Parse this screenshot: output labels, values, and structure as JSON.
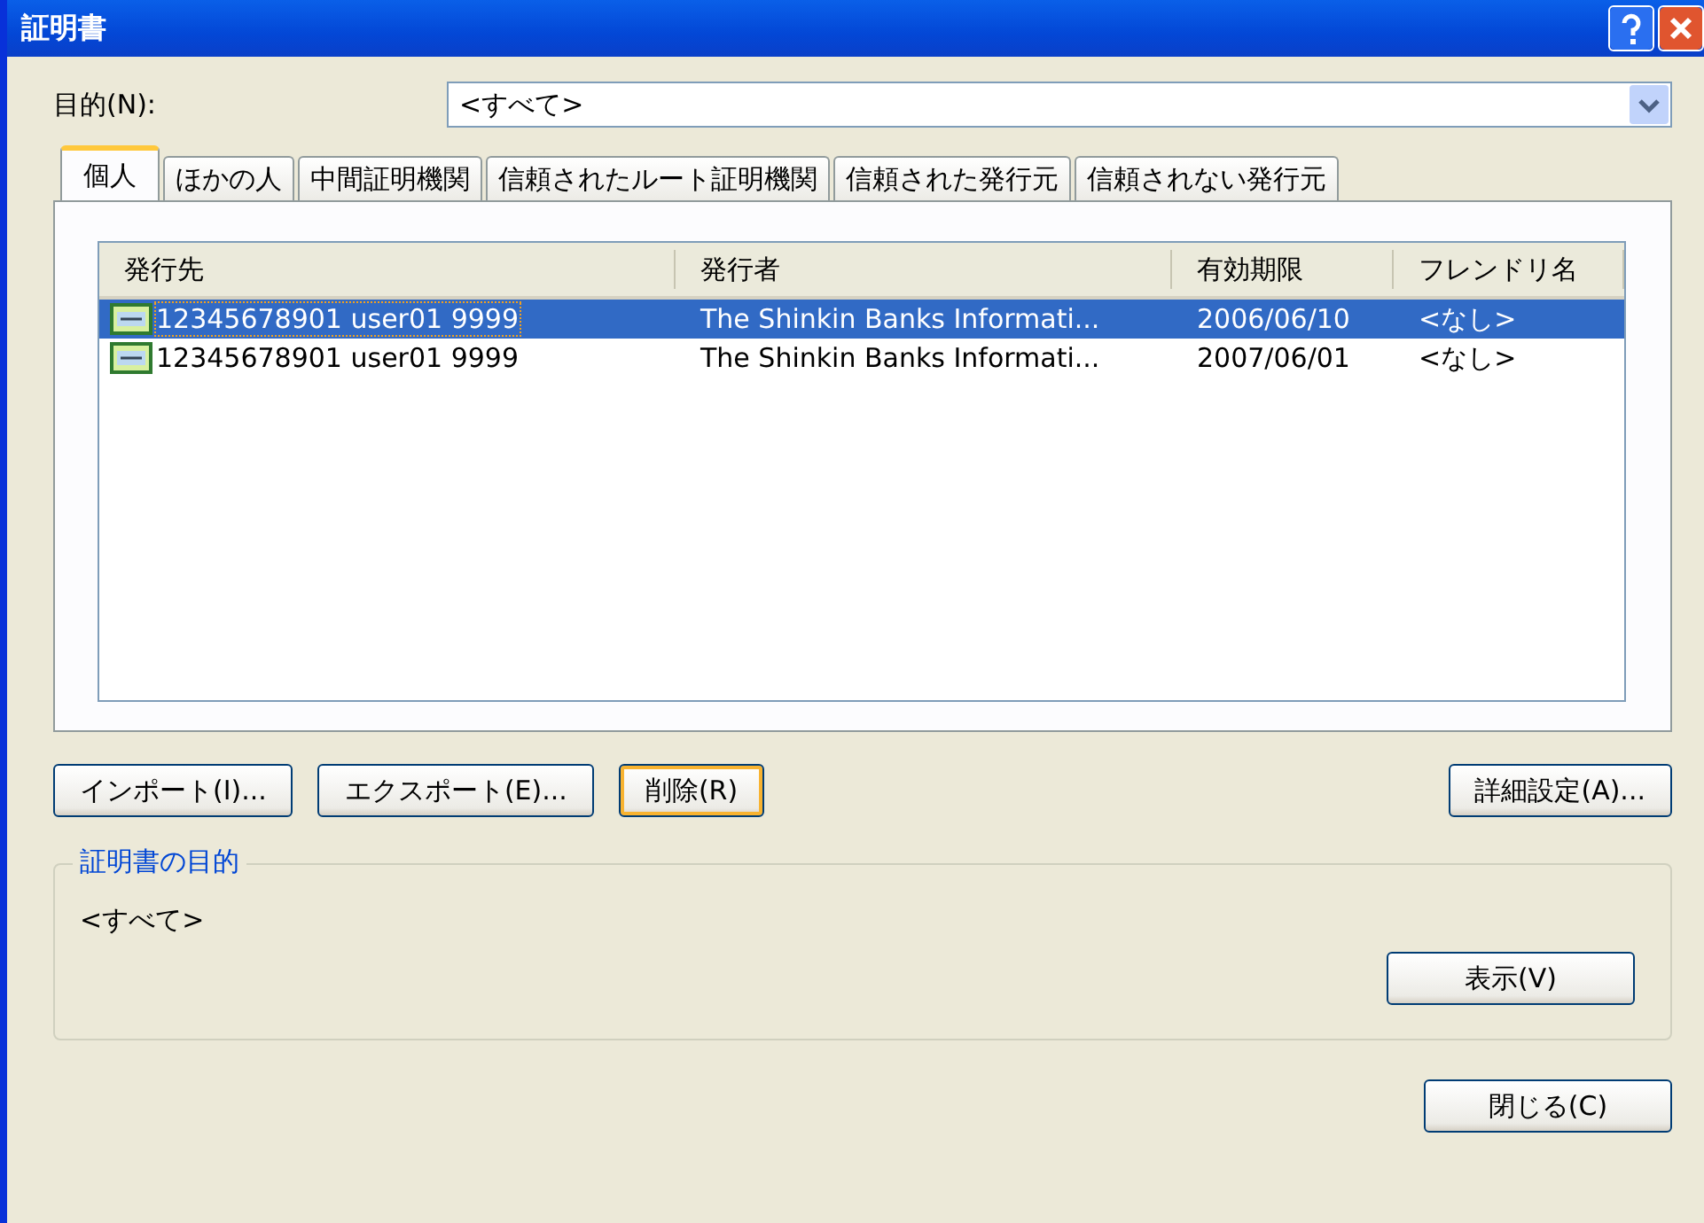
{
  "window": {
    "title": "証明書"
  },
  "purpose": {
    "label": "目的(N):",
    "value": "<すべて>"
  },
  "tabs": [
    {
      "label": "個人",
      "selected": true
    },
    {
      "label": "ほかの人",
      "selected": false
    },
    {
      "label": "中間証明機関",
      "selected": false
    },
    {
      "label": "信頼されたルート証明機関",
      "selected": false
    },
    {
      "label": "信頼された発行元",
      "selected": false
    },
    {
      "label": "信頼されない発行元",
      "selected": false
    }
  ],
  "table": {
    "columns": [
      "発行先",
      "発行者",
      "有効期限",
      "フレンドリ名"
    ],
    "rows": [
      {
        "cells": [
          "12345678901 user01 9999",
          "The Shinkin Banks Informati...",
          "2006/06/10",
          "<なし>"
        ],
        "selected": true
      },
      {
        "cells": [
          "12345678901 user01 9999",
          "The Shinkin Banks Informati...",
          "2007/06/01",
          "<なし>"
        ],
        "selected": false
      }
    ]
  },
  "actions": [
    {
      "label": "インポート(I)...",
      "focused": false
    },
    {
      "label": "エクスポート(E)...",
      "focused": false
    },
    {
      "label": "削除(R)",
      "focused": true
    }
  ],
  "advanced_button": {
    "label": "詳細設定(A)..."
  },
  "purpose_group": {
    "legend": "証明書の目的",
    "text": "<すべて>",
    "button": "表示(V)"
  },
  "close_button": {
    "label": "閉じる(C)"
  }
}
